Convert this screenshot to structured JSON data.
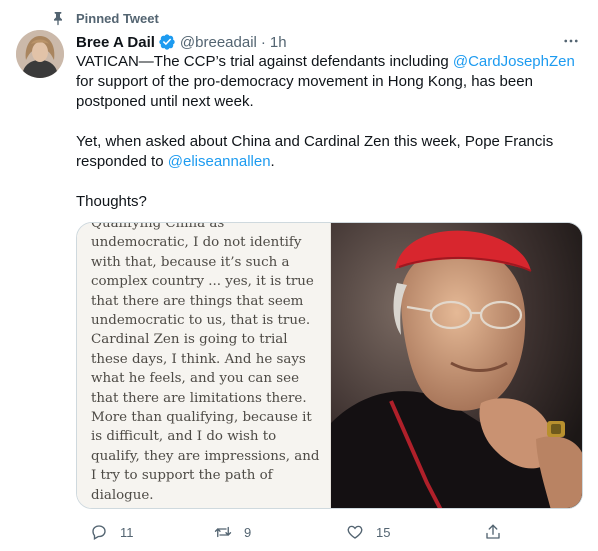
{
  "pinned": {
    "label": "Pinned Tweet",
    "icon": "pin-icon"
  },
  "author": {
    "name": "Bree A Dail",
    "handle": "@breeadail",
    "separator": "·",
    "time": "1h",
    "verified_icon": "verified-badge-icon"
  },
  "tweet": {
    "line1_pre": "VATICAN—The CCP’s trial against defendants including ",
    "mention1": "@CardJosephZen",
    "line1_post": " for support of the pro-democracy movement in Hong Kong, has been postponed until next week.",
    "line2_pre": "Yet, when asked about China and Cardinal Zen this week, Pope Francis responded to ",
    "mention2": "@eliseannallen",
    "line2_post": ".",
    "line3": "Thoughts?"
  },
  "media": {
    "quote_lines": [
      "Qualifying China as",
      "undemocratic, I do not identify",
      "with that, because it’s such a",
      "complex country ... yes, it is true",
      "that there are things that seem",
      "undemocratic to us, that is true.",
      "Cardinal Zen is going to trial",
      "these days, I think. And he says",
      "what he feels, and you can see",
      "that there are limitations there.",
      "More than qualifying, because it",
      "is difficult, and I do wish to",
      "qualify, they are impressions, and",
      "I try to support the path of",
      "dialogue."
    ]
  },
  "actions": {
    "reply_count": "11",
    "retweet_count": "9",
    "like_count": "15",
    "share_label": ""
  },
  "colors": {
    "accent": "#1d9bf0",
    "muted": "#536471",
    "text": "#0f1419",
    "border": "#cfd9de"
  }
}
